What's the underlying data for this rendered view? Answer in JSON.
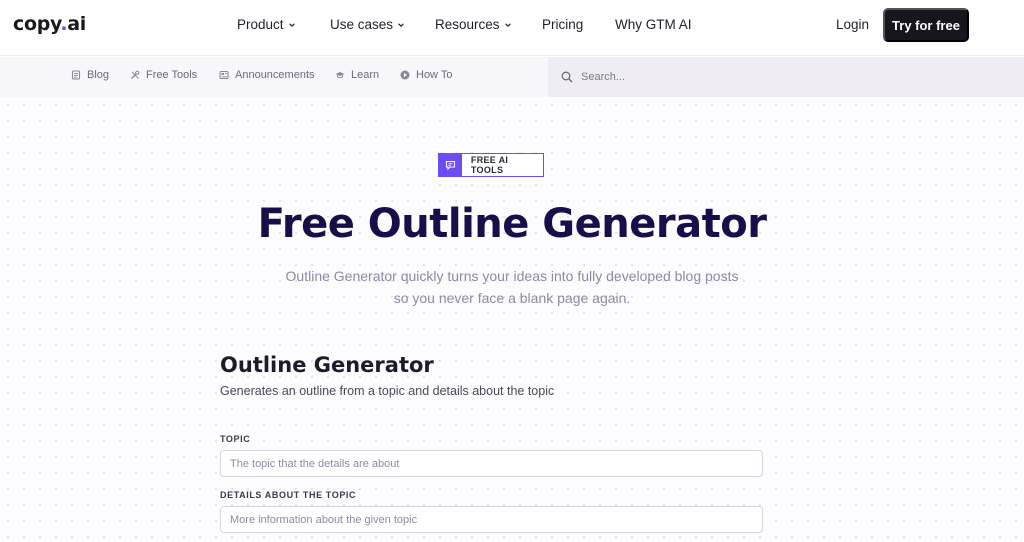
{
  "header": {
    "logo_text": "copy",
    "logo_dot": ".",
    "logo_suffix": "ai",
    "nav": [
      {
        "label": "Product",
        "has_dropdown": true
      },
      {
        "label": "Use cases",
        "has_dropdown": true
      },
      {
        "label": "Resources",
        "has_dropdown": true
      },
      {
        "label": "Pricing",
        "has_dropdown": false
      },
      {
        "label": "Why GTM AI",
        "has_dropdown": false
      }
    ],
    "login_label": "Login",
    "cta_label": "Try for free"
  },
  "subnav": {
    "items": [
      {
        "label": "Blog",
        "icon": "document-icon"
      },
      {
        "label": "Free Tools",
        "icon": "tools-icon"
      },
      {
        "label": "Announcements",
        "icon": "news-icon"
      },
      {
        "label": "Learn",
        "icon": "graduation-cap-icon"
      },
      {
        "label": "How To",
        "icon": "play-icon"
      }
    ],
    "search_placeholder": "Search..."
  },
  "hero": {
    "badge_label": "FREE AI TOOLS",
    "badge_icon": "chat-bubble-icon",
    "title": "Free Outline Generator",
    "subtitle_line1": "Outline Generator quickly turns your ideas into fully developed blog posts",
    "subtitle_line2": "so you never face a blank page again."
  },
  "tool": {
    "title": "Outline Generator",
    "description": "Generates an outline from a topic and details about the topic",
    "fields": [
      {
        "label": "TOPIC",
        "placeholder": "The topic that the details are about",
        "value": ""
      },
      {
        "label": "DETAILS ABOUT THE TOPIC",
        "placeholder": "More information about the given topic",
        "value": ""
      }
    ]
  },
  "colors": {
    "accent": "#6d4cf5",
    "title": "#170e4a",
    "cta_bg": "#16161e"
  }
}
